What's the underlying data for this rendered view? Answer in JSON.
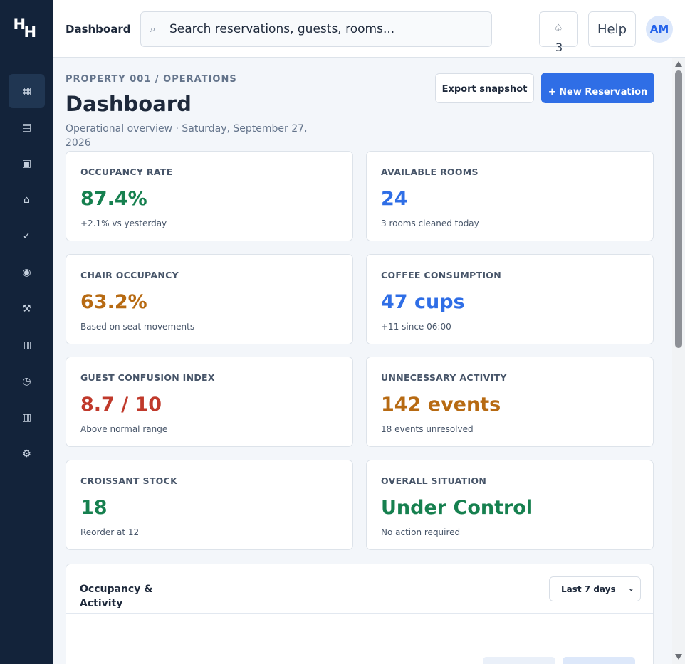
{
  "sidebar": {
    "logo": [
      "H",
      "H"
    ],
    "items": [
      {
        "icon": "dashboard-icon",
        "glyph": "▦",
        "active": true
      },
      {
        "icon": "reservations-icon",
        "glyph": "▤"
      },
      {
        "icon": "calendar-icon",
        "glyph": "▣"
      },
      {
        "icon": "home-icon",
        "glyph": "⌂"
      },
      {
        "icon": "check-icon",
        "glyph": "✓"
      },
      {
        "icon": "guests-icon",
        "glyph": "◉"
      },
      {
        "icon": "tools-icon",
        "glyph": "⚒"
      },
      {
        "icon": "reports-icon",
        "glyph": "▥"
      },
      {
        "icon": "clock-icon",
        "glyph": "◷"
      },
      {
        "icon": "billing-icon",
        "glyph": "▥"
      },
      {
        "icon": "settings-icon",
        "glyph": "⚙"
      }
    ]
  },
  "topbar": {
    "title": "Dashboard",
    "search_icon": "⌕",
    "search_placeholder": "Search reservations, guests, rooms...",
    "bell_icon": "♤",
    "notification_count": "3",
    "help_label": "Help",
    "avatar_initials": "AM"
  },
  "header": {
    "breadcrumb": "PROPERTY 001 / OPERATIONS",
    "title": "Dashboard",
    "subtitle": "Operational overview · Saturday, September 27, 2026",
    "export_label": "Export snapshot",
    "new_label": "+ New Reservation"
  },
  "cards": [
    {
      "label": "OCCUPANCY RATE",
      "value": "87.4%",
      "sub": "+2.1% vs yesterday",
      "tone": "green"
    },
    {
      "label": "AVAILABLE ROOMS",
      "value": "24",
      "sub": "3 rooms cleaned today",
      "tone": "blue"
    },
    {
      "label": "CHAIR OCCUPANCY",
      "value": "63.2%",
      "sub": "Based on seat movements",
      "tone": "orange"
    },
    {
      "label": "COFFEE CONSUMPTION",
      "value": "47 cups",
      "sub": "+11 since 06:00",
      "tone": "blue"
    },
    {
      "label": "GUEST CONFUSION INDEX",
      "value": "8.7 / 10",
      "sub": "Above normal range",
      "tone": "red"
    },
    {
      "label": "UNNECESSARY ACTIVITY",
      "value": "142 events",
      "sub": "18 events unresolved",
      "tone": "orange"
    },
    {
      "label": "CROISSANT STOCK",
      "value": "18",
      "sub": "Reorder at 12",
      "tone": "green"
    },
    {
      "label": "OVERALL SITUATION",
      "value": "Under Control",
      "sub": "No action required",
      "tone": "green"
    }
  ],
  "panel": {
    "title": "Occupancy & Activity",
    "range": "Last 7 days",
    "chevron": "⌄"
  }
}
